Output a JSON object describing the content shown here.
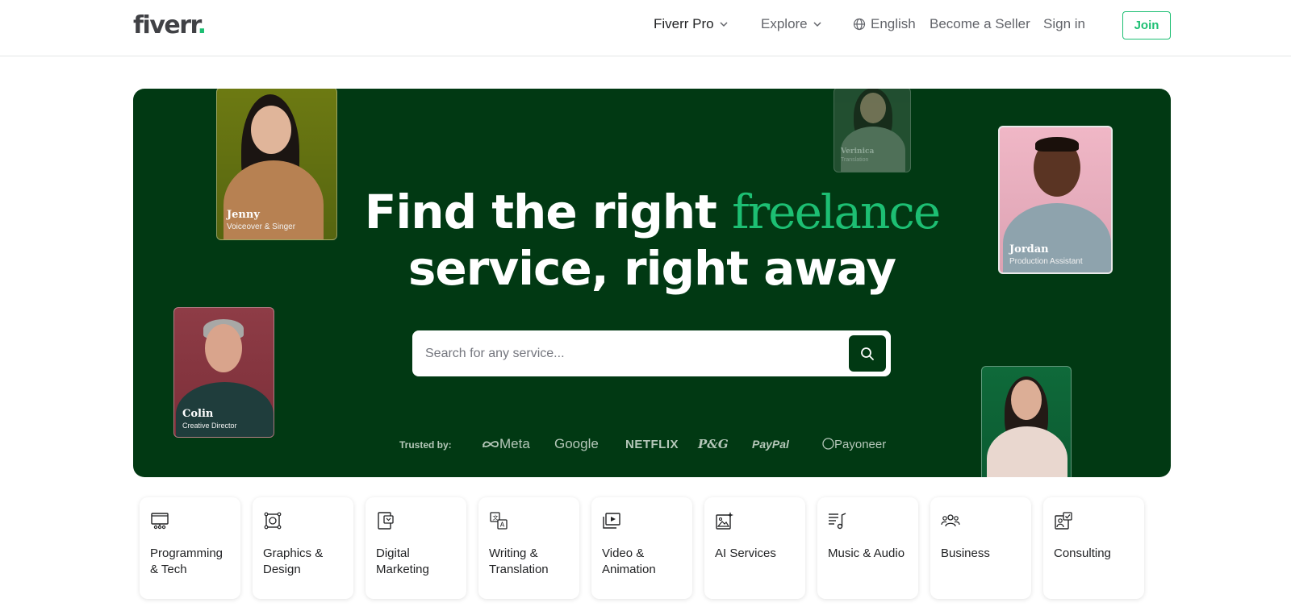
{
  "header": {
    "logo_text": "fiverr",
    "logo_dot": ".",
    "nav": {
      "fiverr_pro": "Fiverr Pro",
      "explore": "Explore",
      "language": "English",
      "become_seller": "Become a Seller",
      "sign_in": "Sign in",
      "join": "Join"
    }
  },
  "hero": {
    "title_part1": "Find the right ",
    "title_accent": "freelance",
    "title_part2": "service, right away",
    "search": {
      "placeholder": "Search for any service..."
    },
    "trusted_label": "Trusted by:",
    "brands": [
      "Meta",
      "Google",
      "NETFLIX",
      "P&G",
      "PayPal",
      "Payoneer"
    ],
    "cards": [
      {
        "name": "Jenny",
        "role": "Voiceover & Singer"
      },
      {
        "name": "Verinica",
        "role": "Translation"
      },
      {
        "name": "Jordan",
        "role": "Production Assistant"
      },
      {
        "name": "Colin",
        "role": "Creative Director"
      }
    ]
  },
  "categories": [
    {
      "label": "Programming\n& Tech",
      "icon": "monitor-icon"
    },
    {
      "label": "Graphics &\nDesign",
      "icon": "design-icon"
    },
    {
      "label": "Digital\nMarketing",
      "icon": "marketing-icon"
    },
    {
      "label": "Writing &\nTranslation",
      "icon": "translation-icon"
    },
    {
      "label": "Video &\nAnimation",
      "icon": "video-icon"
    },
    {
      "label": "AI Services",
      "icon": "ai-icon"
    },
    {
      "label": "Music & Audio",
      "icon": "music-icon"
    },
    {
      "label": "Business",
      "icon": "business-icon"
    },
    {
      "label": "Consulting",
      "icon": "consulting-icon"
    }
  ],
  "colors": {
    "brand_green": "#1dbf73",
    "hero_bg": "#013913"
  }
}
